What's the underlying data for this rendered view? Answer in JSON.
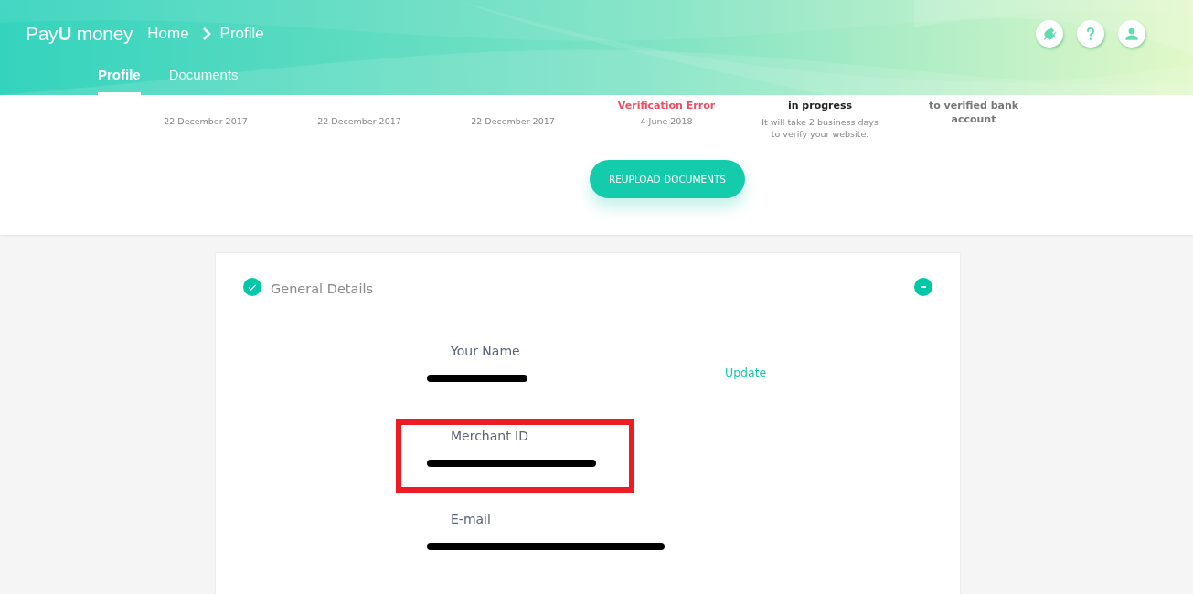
{
  "header": {
    "logo": {
      "prefix": "Pay",
      "mark": "U",
      "suffix": "money"
    },
    "breadcrumb": [
      "Home",
      "Profile"
    ],
    "tabs": [
      {
        "label": "Profile",
        "selected": true
      },
      {
        "label": "Documents",
        "selected": false
      }
    ]
  },
  "document_statuses": [
    {
      "kind": "plain",
      "detail": "22 December 2017"
    },
    {
      "kind": "plain",
      "detail": "22 December 2017"
    },
    {
      "kind": "plain",
      "detail": "22 December 2017"
    },
    {
      "kind": "error",
      "status": "Verification Error",
      "detail": "4 June 2018"
    },
    {
      "kind": "progress",
      "status": "in progress",
      "detail": "It will take 2 business days to verify your website."
    },
    {
      "kind": "info",
      "status": "to verified bank account"
    }
  ],
  "reupload_button": "REUPLOAD DOCUMENTS",
  "general_details": {
    "title": "General Details",
    "verified": true,
    "expanded": true,
    "fields": [
      {
        "label": "Your Name",
        "redacted": true,
        "highlighted": false,
        "action": "Update"
      },
      {
        "label": "Merchant ID",
        "redacted": true,
        "highlighted": true
      },
      {
        "label": "E-mail",
        "redacted": true,
        "highlighted": false
      }
    ]
  }
}
